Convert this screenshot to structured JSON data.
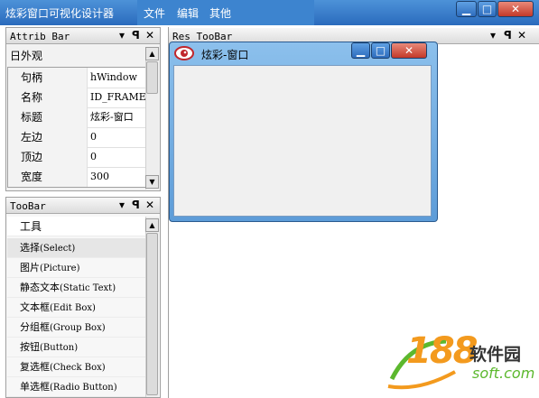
{
  "app": {
    "title": "炫彩窗口可视化设计器"
  },
  "menu": [
    "文件",
    "编辑",
    "其他"
  ],
  "window_controls": {
    "minimize": "▁",
    "maximize": "□",
    "close": "✕"
  },
  "panels": {
    "attrib": {
      "title": "Attrib Bar",
      "icons": {
        "menu": "▾",
        "pin": "ꟼ",
        "close": "✕"
      },
      "group_label": "日外观",
      "rows": [
        {
          "key": "句柄",
          "value": "hWindow"
        },
        {
          "key": "名称",
          "value": "ID_FRAME"
        },
        {
          "key": "标题",
          "value": "炫彩-窗口"
        },
        {
          "key": "左边",
          "value": "0"
        },
        {
          "key": "顶边",
          "value": "0"
        },
        {
          "key": "宽度",
          "value": "300"
        }
      ]
    },
    "toolbar": {
      "title": "TooBar",
      "header": "工具",
      "items": [
        {
          "label": "选择",
          "en": "(Select)"
        },
        {
          "label": "图片",
          "en": "(Picture)"
        },
        {
          "label": "静态文本",
          "en": "(Static Text)"
        },
        {
          "label": "文本框",
          "en": "(Edit Box)"
        },
        {
          "label": "分组框",
          "en": "(Group Box)"
        },
        {
          "label": "按钮",
          "en": "(Button)"
        },
        {
          "label": "复选框",
          "en": "(Check Box)"
        },
        {
          "label": "单选框",
          "en": "(Radio Button)"
        }
      ]
    },
    "res": {
      "title": "Res TooBar"
    }
  },
  "design_window": {
    "title": "炫彩-窗口"
  },
  "watermark": {
    "number": "188",
    "cn": "软件园",
    "domain": "soft.com"
  },
  "colors": {
    "title_bar": "#2a6bbd",
    "accent": "#3d84cf",
    "watermark_green": "#5cb82e",
    "watermark_orange": "#f39a1e"
  }
}
